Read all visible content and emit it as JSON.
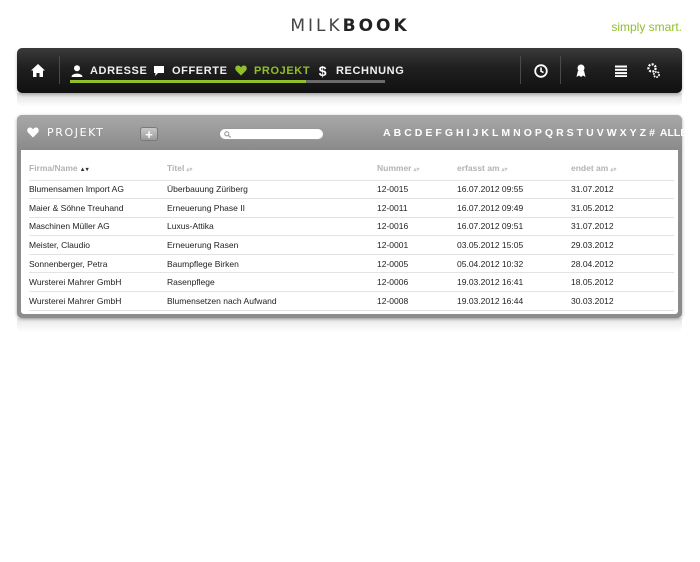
{
  "header": {
    "brand_light": "MILK",
    "brand_bold": "BOOK",
    "tagline": "simply smart."
  },
  "nav": {
    "items": [
      {
        "label": "ADRESSE",
        "icon": "person-icon"
      },
      {
        "label": "OFFERTE",
        "icon": "speech-bubble-icon"
      },
      {
        "label": "PROJEKT",
        "icon": "heart-icon"
      },
      {
        "label": "RECHNUNG",
        "icon": "dollar-icon"
      }
    ],
    "active": "PROJEKT",
    "right_icons": [
      "clock-icon",
      "ribbon-icon",
      "list-icon",
      "settings-icon"
    ],
    "progress": 0.75,
    "accent_color": "#8fbf2a"
  },
  "panel": {
    "title": "PROJEKT",
    "add_label": "+",
    "search_placeholder": "",
    "alphabet": [
      "A",
      "B",
      "C",
      "D",
      "E",
      "F",
      "G",
      "H",
      "I",
      "J",
      "K",
      "L",
      "M",
      "N",
      "O",
      "P",
      "Q",
      "R",
      "S",
      "T",
      "U",
      "V",
      "W",
      "X",
      "Y",
      "Z",
      "#",
      "ALLE"
    ]
  },
  "table": {
    "columns": [
      "Firma/Name",
      "Titel",
      "Nummer",
      "erfasst am",
      "endet am"
    ],
    "rows": [
      [
        "Blumensamen Import AG",
        "Überbauung Züriberg",
        "12-0015",
        "16.07.2012 09:55",
        "31.07.2012"
      ],
      [
        "Maier & Söhne Treuhand",
        "Erneuerung Phase II",
        "12-0011",
        "16.07.2012 09:49",
        "31.05.2012"
      ],
      [
        "Maschinen Müller AG",
        "Luxus-Attika",
        "12-0016",
        "16.07.2012 09:51",
        "31.07.2012"
      ],
      [
        "Meister, Claudio",
        "Erneuerung Rasen",
        "12-0001",
        "03.05.2012 15:05",
        "29.03.2012"
      ],
      [
        "Sonnenberger, Petra",
        "Baumpflege Birken",
        "12-0005",
        "05.04.2012 10:32",
        "28.04.2012"
      ],
      [
        "Wursterei Mahrer GmbH",
        "Rasenpflege",
        "12-0006",
        "19.03.2012 16:41",
        "18.05.2012"
      ],
      [
        "Wursterei Mahrer GmbH",
        "Blumensetzen nach Aufwand",
        "12-0008",
        "19.03.2012 16:44",
        "30.03.2012"
      ]
    ]
  }
}
